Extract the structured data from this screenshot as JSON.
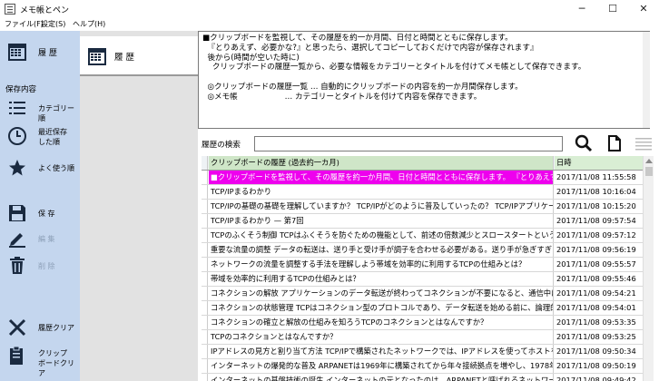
{
  "window": {
    "title": "メモ帳とペン",
    "minimize": "─",
    "maximize": "☐",
    "close": "✕"
  },
  "menu": [
    "ファイル(F)",
    "設定(S)",
    "ヘルプ(H)"
  ],
  "sidebar": {
    "history": "履 歴",
    "section_title": "保存内容",
    "by_category": "カテゴリー順",
    "by_recent": "最近保存\nした順",
    "favorites": "よく使う順",
    "save": "保 存",
    "edit": "編 集",
    "delete": "削 除",
    "clear_history": "履歴クリア",
    "clear_clipboard": "クリップ\nボードクリア"
  },
  "panel": {
    "title": "履 歴"
  },
  "editor": {
    "lines": [
      "■クリップボードを監視して、その履歴を約一か月間、日付と時間とともに保存します。",
      "  『とりあえず、必要かな?』と思ったら、選択してコピーしておくだけで内容が保存されます』",
      "  後から(時間が空いた時に)",
      "    クリップボードの履歴一覧から、必要な情報をカテゴリーとタイトルを付けてメモ帳として保存できます。",
      "",
      "  ◎クリップボードの履歴一覧 … 自動的にクリップボードの内容を約一か月間保存します。",
      "  ◎メモ帳                   … カテゴリーとタイトルを付けて内容を保存できます。"
    ]
  },
  "search": {
    "label": "履歴の検索",
    "placeholder": ""
  },
  "grid": {
    "columns": [
      "クリップボードの履歴 (過去約一カ月)",
      "日時"
    ],
    "rows": [
      {
        "text": "■クリップボードを監視して、その履歴を約一か月間、日付と時間とともに保存します。 『とりあえず、必",
        "date": "2017/11/08 11:55:58"
      },
      {
        "text": "TCP/IPまるわかり",
        "date": "2017/11/08 10:16:04"
      },
      {
        "text": "TCP/IPの基礎の基礎を理解していますか？ TCP/IPがどのように普及していったの？ TCP/IPアプリケーシ",
        "date": "2017/11/08 10:15:20"
      },
      {
        "text": "TCP/IPまるわかり — 第7回",
        "date": "2017/11/08 09:57:54"
      },
      {
        "text": "TCPのふくそう制御  TCPはふくそうを防ぐための機能として、前述の倍数減少とスロースタートという2つの機",
        "date": "2017/11/08 09:57:12"
      },
      {
        "text": "重要な流量の調整  データの転送は、送り手と受け手が調子を合わせる必要がある。送り手が急ぎすぎ",
        "date": "2017/11/08 09:56:19"
      },
      {
        "text": "ネットワークの流量を調整する手法を理解しよう帯域を効率的に利用するTCPの仕組みとは？",
        "date": "2017/11/08 09:55:57"
      },
      {
        "text": "帯域を効率的に利用するTCPの仕組みとは？",
        "date": "2017/11/08 09:55:46"
      },
      {
        "text": "コネクションの解放  アプリケーションのデータ転送が終わってコネクションが不要になると、通信中に利用し",
        "date": "2017/11/08 09:54:21"
      },
      {
        "text": "コネクションの状態管理  TCPはコネクション型のプロトコルであり、データ転送を始める前に、論理的な通",
        "date": "2017/11/08 09:54:01"
      },
      {
        "text": "コネクションの確立と解放の仕組みを知ろうTCPのコネクションとはなんですか？",
        "date": "2017/11/08 09:53:35"
      },
      {
        "text": "TCPのコネクションとはなんですか？",
        "date": "2017/11/08 09:53:25"
      },
      {
        "text": "IPアドレスの見方と割り当て方法  TCP/IPで構築されたネットワークでは、IPアドレスを使ってホストを識別",
        "date": "2017/11/08 09:50:34"
      },
      {
        "text": "インターネットの爆発的な普及  ARPANETは1969年に構築されてから年々接続拠点を増やし、1978年",
        "date": "2017/11/08 09:50:19"
      },
      {
        "text": "インターネットの基盤技術の誕生  インターネットの元となったのは、ARPANETと呼ばれるネットワークであ",
        "date": "2017/11/08 09:49:42"
      }
    ]
  }
}
